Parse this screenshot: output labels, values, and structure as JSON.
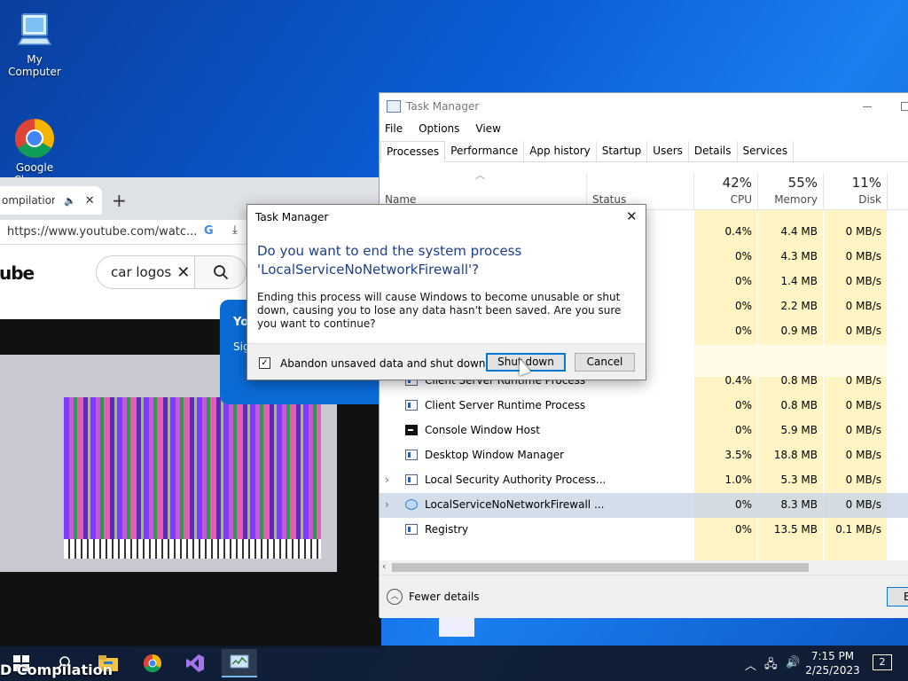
{
  "desktop": {
    "icons": [
      {
        "label": "My Computer",
        "icon": "computer-icon"
      },
      {
        "label": "Google\nChrome",
        "icon": "chrome-icon"
      }
    ]
  },
  "browser": {
    "tab_title": "ompilation",
    "url": "https://www.youtube.com/watc...",
    "logo_text": "ube",
    "search_value": "car logos",
    "popup_line1": "Yo",
    "popup_line2": "Sig"
  },
  "task_manager": {
    "title": "Task Manager",
    "menu": [
      "File",
      "Options",
      "View"
    ],
    "tabs": [
      "Processes",
      "Performance",
      "App history",
      "Startup",
      "Users",
      "Details",
      "Services"
    ],
    "columns": {
      "name": "Name",
      "status": "Status",
      "cpu_pct": "42%",
      "cpu": "CPU",
      "mem_pct": "55%",
      "mem": "Memory",
      "disk_pct": "11%",
      "disk": "Disk"
    },
    "rows": [
      {
        "name": "",
        "cpu": "0.4%",
        "mem": "4.4 MB",
        "disk": "0 MB/s"
      },
      {
        "name": "",
        "cpu": "0%",
        "mem": "4.3 MB",
        "disk": "0 MB/s"
      },
      {
        "name": "",
        "cpu": "0%",
        "mem": "1.4 MB",
        "disk": "0 MB/s"
      },
      {
        "name": "",
        "cpu": "0%",
        "mem": "2.2 MB",
        "disk": "0 MB/s"
      },
      {
        "name": "",
        "cpu": "0%",
        "mem": "0.9 MB",
        "disk": "0 MB/s"
      },
      {
        "name": "",
        "cpu": "",
        "mem": "",
        "disk": ""
      },
      {
        "name": "Client Server Runtime Process",
        "cpu": "0.4%",
        "mem": "0.8 MB",
        "disk": "0 MB/s"
      },
      {
        "name": "Client Server Runtime Process",
        "cpu": "0%",
        "mem": "0.8 MB",
        "disk": "0 MB/s"
      },
      {
        "name": "Console Window Host",
        "cpu": "0%",
        "mem": "5.9 MB",
        "disk": "0 MB/s"
      },
      {
        "name": "Desktop Window Manager",
        "cpu": "3.5%",
        "mem": "18.8 MB",
        "disk": "0 MB/s"
      },
      {
        "name": "Local Security Authority Process...",
        "cpu": "1.0%",
        "mem": "5.3 MB",
        "disk": "0 MB/s"
      },
      {
        "name": "LocalServiceNoNetworkFirewall ...",
        "cpu": "0%",
        "mem": "8.3 MB",
        "disk": "0 MB/s"
      },
      {
        "name": "Registry",
        "cpu": "0%",
        "mem": "13.5 MB",
        "disk": "0.1 MB/s"
      }
    ],
    "fewer_details": "Fewer details",
    "end_button": "E"
  },
  "dialog": {
    "title": "Task Manager",
    "question_line1": "Do you want to end the system process",
    "question_line2": "'LocalServiceNoNetworkFirewall'?",
    "body": "Ending this process will cause Windows to become unusable or shut down, causing you to lose any data hasn't been saved. Are you sure you want to continue?",
    "checkbox_label": "Abandon unsaved data and shut down.",
    "checkbox_checked": true,
    "shutdown_label": "Shut down",
    "cancel_label": "Cancel"
  },
  "taskbar": {
    "time": "7:15 PM",
    "date": "2/25/2023",
    "notifications": "2",
    "overlay_text": "D Compilation"
  }
}
